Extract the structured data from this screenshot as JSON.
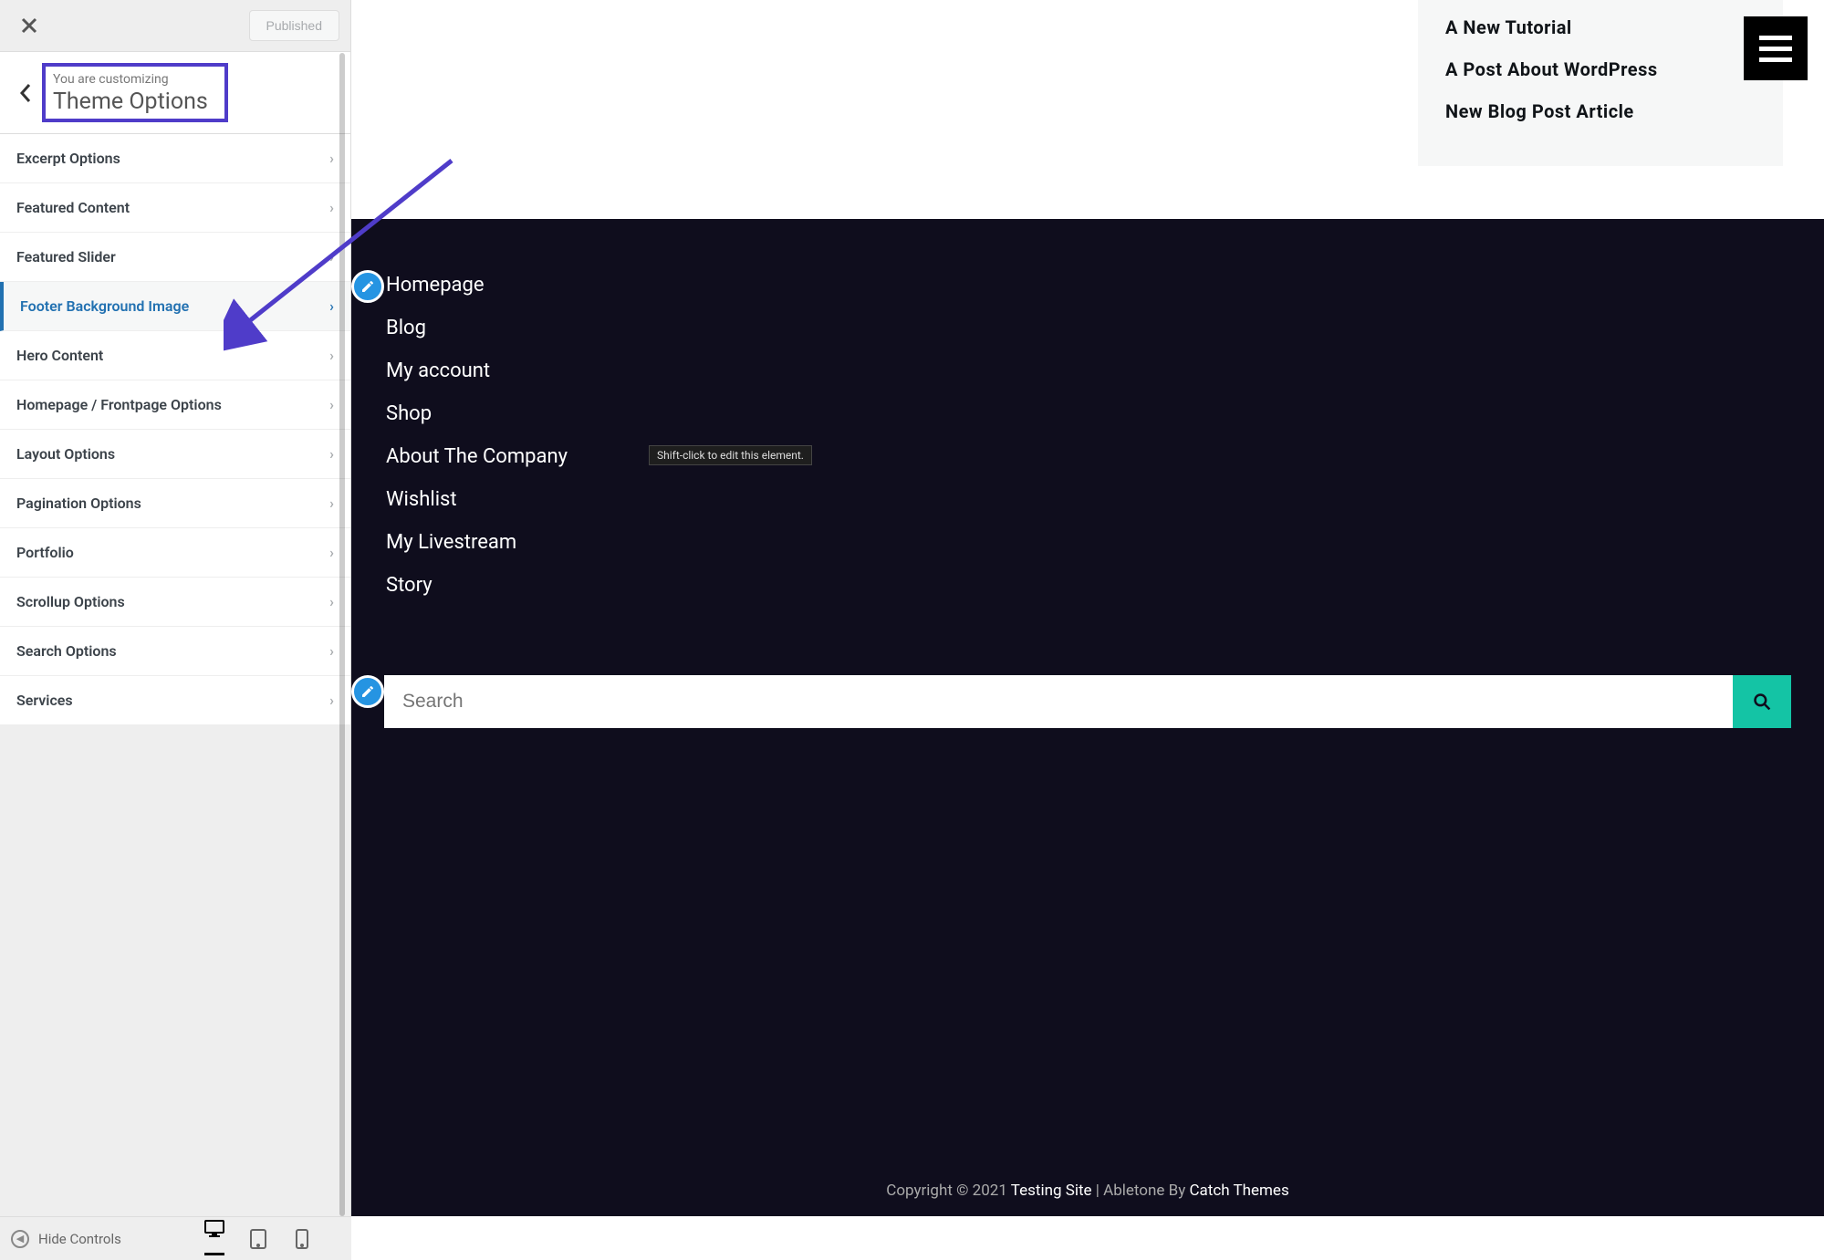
{
  "topbar": {
    "publish_label": "Published"
  },
  "panel": {
    "subtitle": "You are customizing",
    "title": "Theme Options"
  },
  "options": [
    {
      "label": "Excerpt Options",
      "active": false
    },
    {
      "label": "Featured Content",
      "active": false
    },
    {
      "label": "Featured Slider",
      "active": false
    },
    {
      "label": "Footer Background Image",
      "active": true
    },
    {
      "label": "Hero Content",
      "active": false
    },
    {
      "label": "Homepage / Frontpage Options",
      "active": false
    },
    {
      "label": "Layout Options",
      "active": false
    },
    {
      "label": "Pagination Options",
      "active": false
    },
    {
      "label": "Portfolio",
      "active": false
    },
    {
      "label": "Scrollup Options",
      "active": false
    },
    {
      "label": "Search Options",
      "active": false
    },
    {
      "label": "Services",
      "active": false
    }
  ],
  "preview": {
    "recent_posts": [
      "A New Tutorial",
      "A Post About WordPress",
      "New Blog Post Article"
    ],
    "footer_links": [
      "Homepage",
      "Blog",
      "My account",
      "Shop",
      "About The Company",
      "Wishlist",
      "My Livestream",
      "Story"
    ],
    "tooltip": "Shift-click to edit this element.",
    "search_placeholder": "Search",
    "copyright_prefix": "Copyright © 2021 ",
    "copyright_site": "Testing Site",
    "copyright_mid": " | Abletone By ",
    "copyright_theme": "Catch Themes"
  },
  "bottombar": {
    "hide_label": "Hide Controls"
  }
}
